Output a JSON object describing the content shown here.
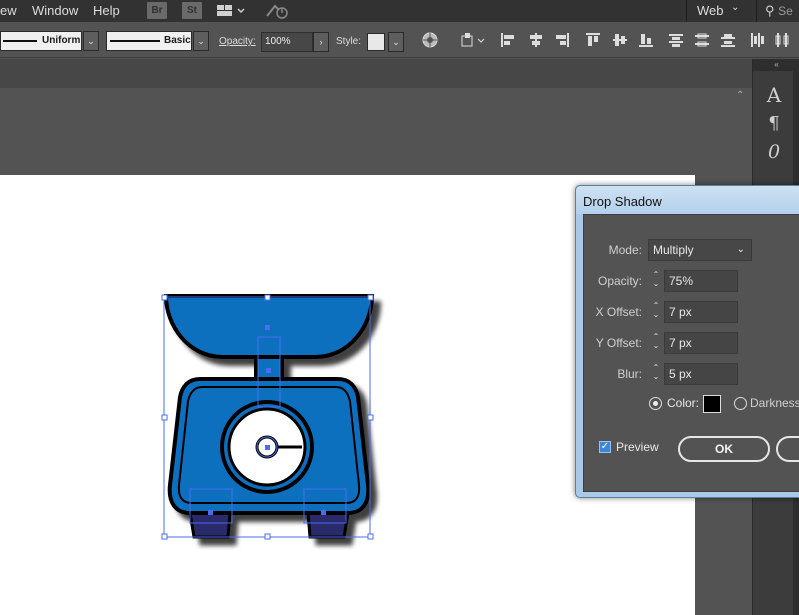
{
  "menubar": {
    "items": [
      "ew",
      "Window",
      "Help"
    ],
    "badges": [
      "Br",
      "St"
    ],
    "workspace": "Web",
    "search_placeholder": "Se"
  },
  "controlbar": {
    "stroke_profile": "Uniform",
    "brush": "Basic",
    "opacity_label": "Opacity:",
    "opacity_value": "100%",
    "style_label": "Style:"
  },
  "dialog": {
    "title": "Drop Shadow",
    "mode_label": "Mode:",
    "mode_value": "Multiply",
    "opacity_label": "Opacity:",
    "opacity_value": "75%",
    "xoffset_label": "X Offset:",
    "xoffset_value": "7 px",
    "yoffset_label": "Y Offset:",
    "yoffset_value": "7 px",
    "blur_label": "Blur:",
    "blur_value": "5 px",
    "color_label": "Color:",
    "color_swatch": "#000000",
    "color_selected": true,
    "darkness_label": "Darkness:",
    "preview_label": "Preview",
    "preview_checked": true,
    "ok_label": "OK"
  },
  "rpanel": {
    "tools": [
      "character-icon",
      "paragraph-icon",
      "opentype-icon"
    ]
  },
  "colors": {
    "scale_blue": "#0f6fbf",
    "scale_dark": "#2a2a6a",
    "selection": "#4a6cf0",
    "dialog_frame": "#aac9e6"
  }
}
